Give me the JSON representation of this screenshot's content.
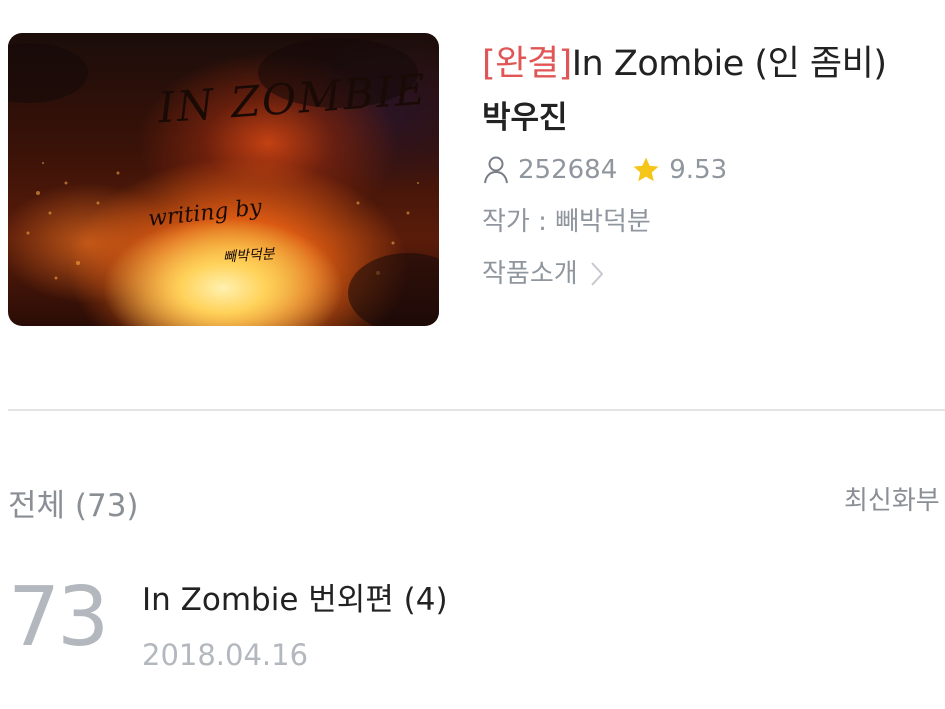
{
  "cover": {
    "title": "IN ZOMBIE",
    "subtitle": "writing by",
    "author": "빼박덕분"
  },
  "work": {
    "status_tag": "[완결]",
    "title": "In Zombie (인 좀비)",
    "author": "박우진",
    "views": "252684",
    "rating": "9.53",
    "writer": "작가 : 빼박덕분",
    "intro_label": "작품소개"
  },
  "list": {
    "total_label": "전체 (73)",
    "sort_label": "최신화부"
  },
  "episodes": [
    {
      "number": "73",
      "title": "In Zombie 번외편 (4)",
      "date": "2018.04.16"
    }
  ],
  "colors": {
    "status_tag": "#e05555",
    "star": "#f5c518",
    "muted_text": "#8f969e"
  },
  "icons": {
    "views": "person-icon",
    "rating": "star-icon",
    "intro": "chevron-right-icon"
  }
}
